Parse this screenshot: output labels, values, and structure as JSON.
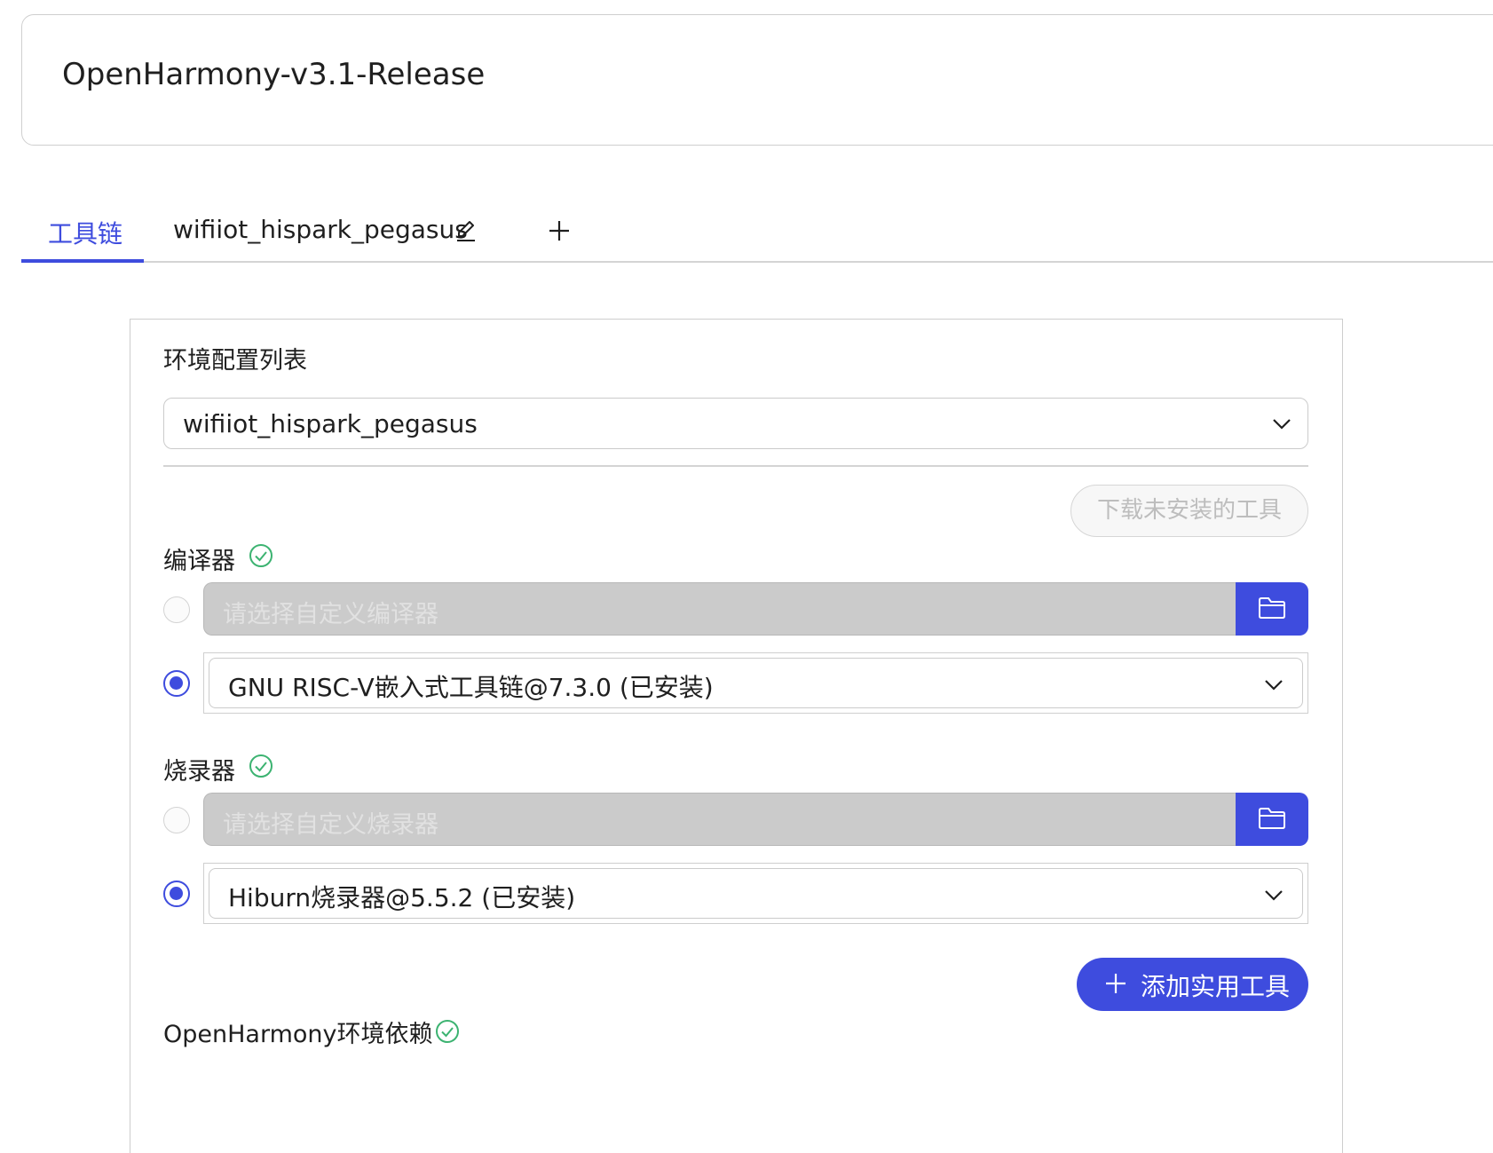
{
  "project": {
    "title": "OpenHarmony-v3.1-Release"
  },
  "tabs": [
    {
      "label": "工具链",
      "active": true
    },
    {
      "label": "wifiiot_hispark_pegasus",
      "active": false
    }
  ],
  "panel": {
    "env_list_label": "环境配置列表",
    "env_selected": "wifiiot_hispark_pegasus",
    "download_button": "下载未安装的工具",
    "compiler": {
      "label": "编译器",
      "custom_placeholder": "请选择自定义编译器",
      "selected": "GNU RISC-V嵌入式工具链@7.3.0 (已安装)"
    },
    "burner": {
      "label": "烧录器",
      "custom_placeholder": "请选择自定义烧录器",
      "selected": "Hiburn烧录器@5.5.2 (已安装)"
    },
    "add_utility_button": "添加实用工具",
    "dependency_label": "OpenHarmony环境依赖"
  },
  "colors": {
    "accent": "#3e4cde",
    "success": "#3cb371",
    "disabled_fill": "#cbcbcb"
  },
  "icons": [
    "edit-icon",
    "plus-icon",
    "check-circle-icon",
    "chevron-down-icon",
    "folder-icon"
  ]
}
